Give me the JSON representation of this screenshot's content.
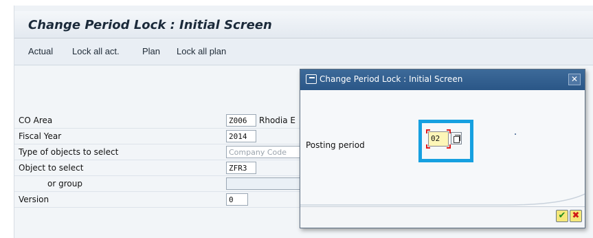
{
  "window": {
    "title": "Change Period Lock : Initial Screen"
  },
  "toolbar": {
    "items": [
      "Actual",
      "Lock all act.",
      "Plan",
      "Lock all plan"
    ]
  },
  "form": {
    "rows": [
      {
        "label": "CO Area",
        "value": "Z006",
        "after": "Rhodia E"
      },
      {
        "label": "Fiscal Year",
        "value": "2014"
      },
      {
        "label": "Type of objects to select",
        "value": "Company Code"
      },
      {
        "label": "Object to select",
        "value": "ZFR3"
      },
      {
        "label": "or group",
        "value": ""
      },
      {
        "label": "Version",
        "value": "0"
      }
    ]
  },
  "dialog": {
    "title": "Change Period Lock : Initial Screen",
    "close_glyph": "✕",
    "posting_period_label": "Posting period",
    "posting_period_value": "02",
    "ok_glyph": "✔",
    "cancel_glyph": "✖"
  },
  "colors": {
    "highlight_box": "#16a0e0",
    "dialog_header": "#2f5e90",
    "confirm_green": "#1e8a1e",
    "cancel_red": "#d01818"
  }
}
